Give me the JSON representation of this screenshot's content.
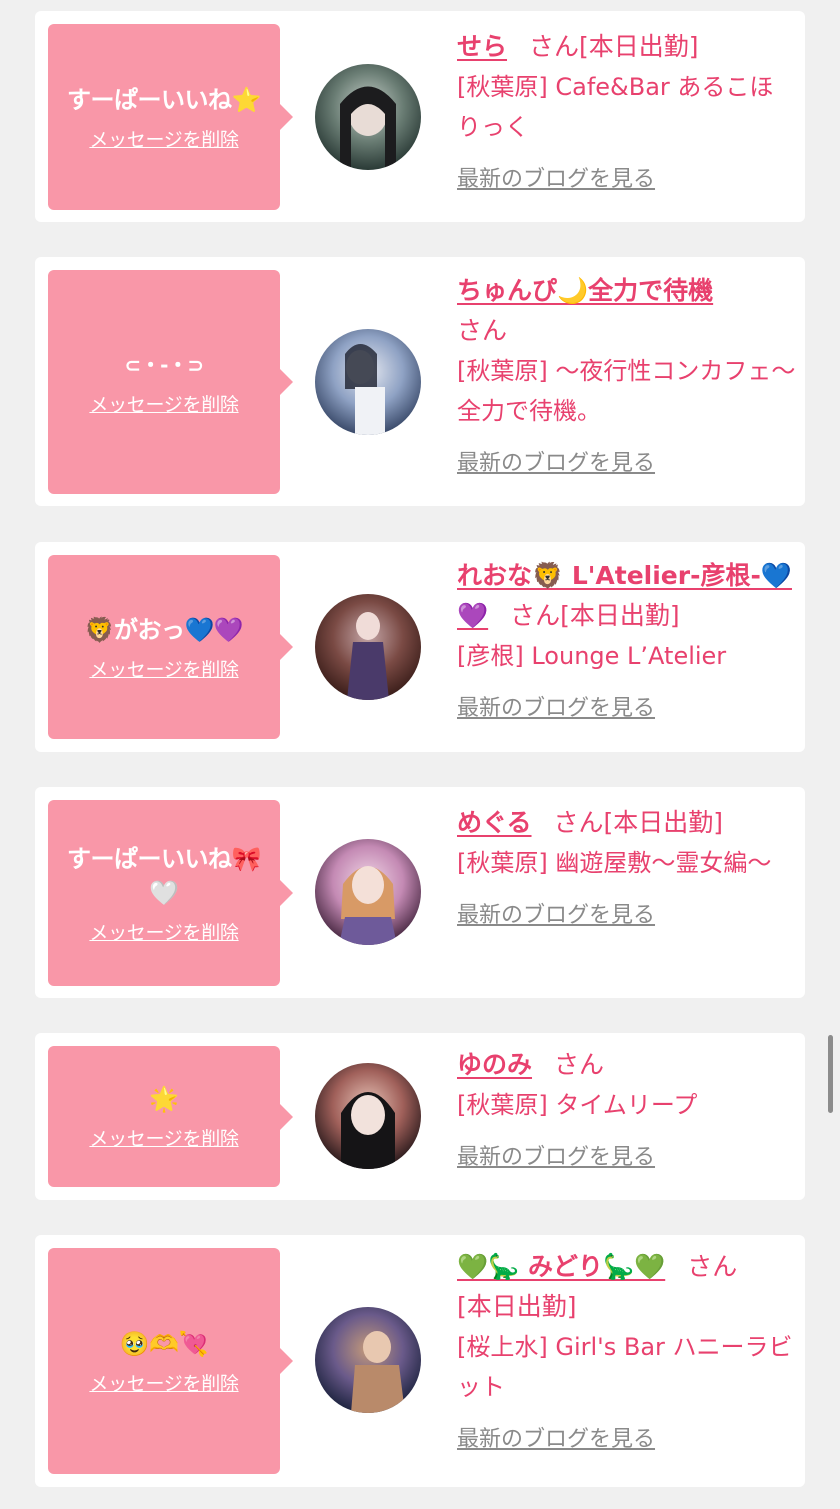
{
  "items": [
    {
      "message": "すーぱーいいね⭐️",
      "delete_label": "メッセージを削除",
      "name": "せら",
      "san": "さん",
      "shift": "[本日出勤]",
      "shop": "[秋葉原] Cafe&Bar あるこほりっく",
      "blog_label": "最新のブログを見る",
      "avatar_colors": [
        "#2a3a36",
        "#6a7d74",
        "#c9d2cc"
      ]
    },
    {
      "message": "⊂・-・⊃",
      "delete_label": "メッセージを削除",
      "name": "ちゅんぴ🌙全力で待機",
      "san": "さん",
      "shift": "",
      "shop": "[秋葉原] 〜夜行性コンカフェ〜全力で待機。",
      "blog_label": "最新のブログを見る",
      "avatar_colors": [
        "#3a4a6a",
        "#8fa2c4",
        "#e5e8f0"
      ]
    },
    {
      "message": "🦁がおっ💙💜",
      "delete_label": "メッセージを削除",
      "name": "れおな🦁 L'Atelier-彦根-💙💜",
      "san": "さん",
      "shift": "[本日出勤]",
      "shop": "[彦根] Lounge L’Atelier",
      "blog_label": "最新のブログを見る",
      "avatar_colors": [
        "#3b1e1a",
        "#7a4a44",
        "#c4a6a8"
      ]
    },
    {
      "message": "すーぱーいいね🎀🤍",
      "delete_label": "メッセージを削除",
      "name": "めぐる",
      "san": "さん",
      "shift": "[本日出勤]",
      "shop": "[秋葉原] 幽遊屋敷〜霊女編〜",
      "blog_label": "最新のブログを見る",
      "avatar_colors": [
        "#4a2a44",
        "#c48ab4",
        "#f0d6e6"
      ]
    },
    {
      "message": "🌟",
      "delete_label": "メッセージを削除",
      "name": "ゆのみ",
      "san": "さん",
      "shift": "",
      "shop": "[秋葉原] タイムリープ",
      "blog_label": "最新のブログを見る",
      "avatar_colors": [
        "#2a1a1c",
        "#a0605a",
        "#e8c4b8"
      ]
    },
    {
      "message": "🥹🫶💘",
      "delete_label": "メッセージを削除",
      "name": "💚🦕 みどり🦕💚",
      "san": "さん",
      "shift": "[本日出勤]",
      "shop": "[桜上水] Girl's Bar ハニーラビット",
      "blog_label": "最新のブログを見る",
      "avatar_colors": [
        "#1e2440",
        "#6a5a8a",
        "#c49a7a"
      ]
    }
  ]
}
